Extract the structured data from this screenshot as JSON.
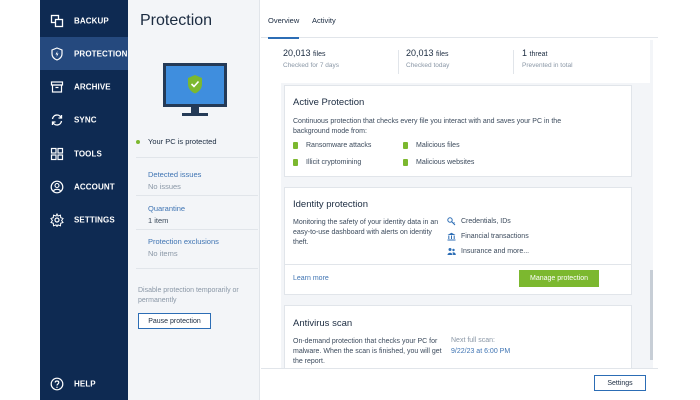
{
  "sidebar": {
    "items": [
      {
        "label": "BACKUP",
        "icon": "copy-icon"
      },
      {
        "label": "PROTECTION",
        "icon": "shield-icon"
      },
      {
        "label": "ARCHIVE",
        "icon": "archive-icon"
      },
      {
        "label": "SYNC",
        "icon": "sync-icon"
      },
      {
        "label": "TOOLS",
        "icon": "grid-icon"
      },
      {
        "label": "ACCOUNT",
        "icon": "user-icon"
      },
      {
        "label": "SETTINGS",
        "icon": "gear-icon"
      }
    ],
    "active": "PROTECTION",
    "help_label": "HELP"
  },
  "panel": {
    "title": "Protection",
    "status": "Your PC is protected",
    "detected_issues": {
      "label": "Detected issues",
      "value": "No issues"
    },
    "quarantine": {
      "label": "Quarantine",
      "value": "1 item"
    },
    "exclusions": {
      "label": "Protection exclusions",
      "value": "No items"
    },
    "disable_text": "Disable protection temporarily or permanently",
    "pause_label": "Pause protection"
  },
  "tabs": [
    {
      "label": "Overview",
      "active": true
    },
    {
      "label": "Activity",
      "active": false
    }
  ],
  "stats": [
    {
      "number": "20,013",
      "unit": "files",
      "label": "Checked for 7 days"
    },
    {
      "number": "20,013",
      "unit": "files",
      "label": "Checked today"
    },
    {
      "number": "1",
      "unit": "threat",
      "label": "Prevented in total"
    }
  ],
  "active_protection": {
    "title": "Active Protection",
    "desc": "Continuous protection that checks every file you interact with and saves your PC in the background mode from:",
    "features": [
      "Ransomware attacks",
      "Malicious files",
      "Illicit cryptomining",
      "Malicious websites"
    ]
  },
  "identity": {
    "title": "Identity protection",
    "desc": "Monitoring the safety of your identity data in an easy-to-use dashboard with alerts on identity theft.",
    "items": [
      "Credentials, IDs",
      "Financial transactions",
      "Insurance and more..."
    ],
    "learn_more": "Learn more",
    "manage_label": "Manage protection"
  },
  "antivirus": {
    "title": "Antivirus scan",
    "desc": "On-demand protection that checks your PC for malware. When the scan is finished, you will get the report.",
    "next_label": "Next full scan:",
    "next_value": "9/22/23 at 6:00 PM"
  },
  "footer": {
    "settings_label": "Settings"
  },
  "colors": {
    "sidebar": "#0e2a52",
    "sidebar_active": "#25497e",
    "accent": "#2c6db5",
    "green": "#7cb82f",
    "link": "#3f74b3"
  }
}
